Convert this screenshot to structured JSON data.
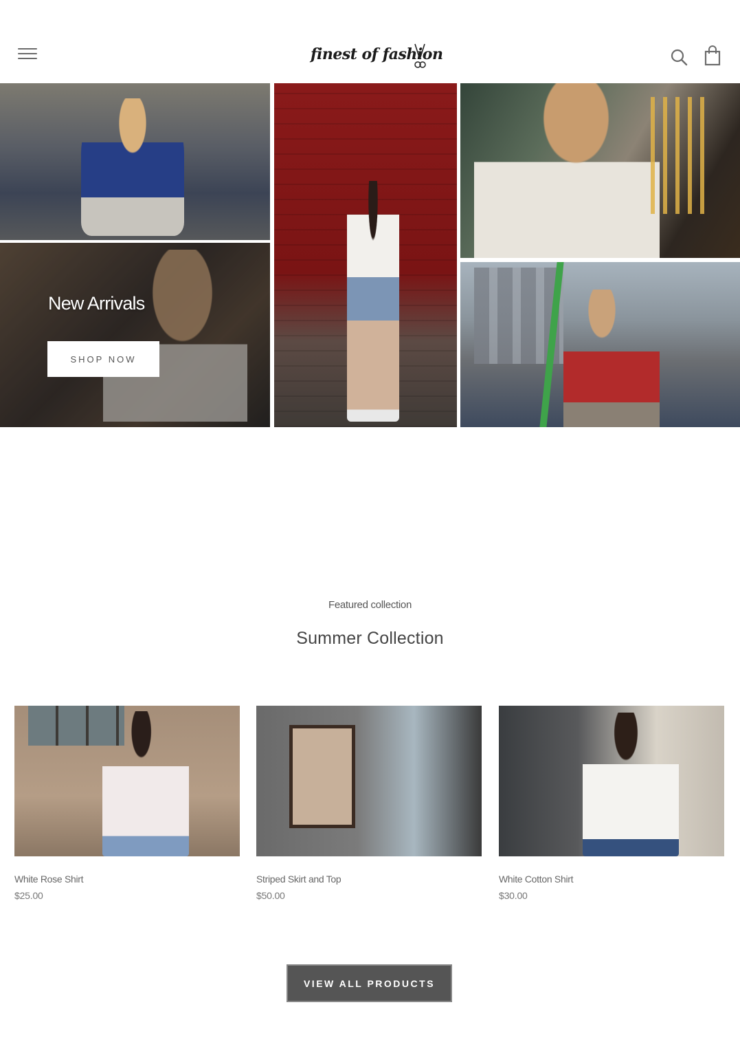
{
  "header": {
    "logo_text": "finest of fashion",
    "menu_icon": "hamburger-menu-icon",
    "search_icon": "search-icon",
    "cart_icon": "shopping-bag-icon"
  },
  "hero": {
    "title": "New Arrivals",
    "button_label": "SHOP NOW"
  },
  "featured": {
    "subtitle": "Featured collection",
    "title": "Summer Collection",
    "products": [
      {
        "name": "White Rose Shirt",
        "price": "$25.00"
      },
      {
        "name": "Striped Skirt and Top",
        "price": "$50.00"
      },
      {
        "name": "White Cotton Shirt",
        "price": "$30.00"
      }
    ],
    "view_all_label": "VIEW ALL PRODUCTS"
  },
  "colors": {
    "background": "#ffffff",
    "view_all_button": "#555555",
    "text_muted": "#666666"
  }
}
